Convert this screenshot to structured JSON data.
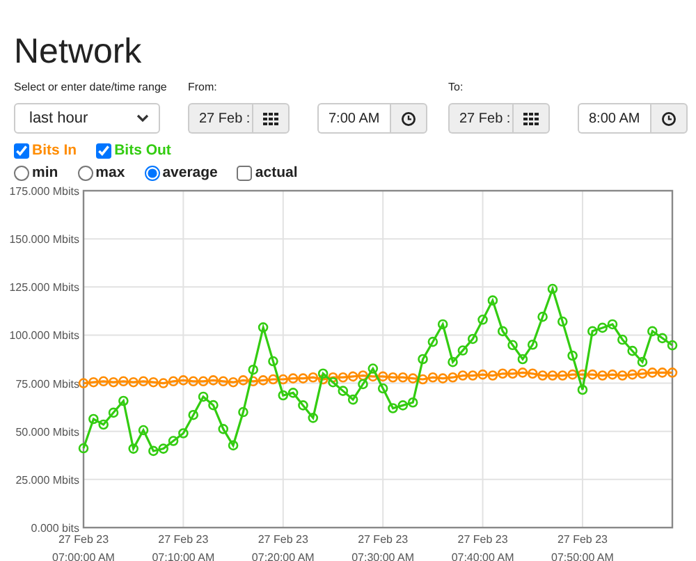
{
  "title": "Network",
  "range": {
    "label": "Select or enter date/time range",
    "value": "last hour"
  },
  "from": {
    "label": "From:",
    "date": "27 Feb :",
    "time": "7:00 AM"
  },
  "to": {
    "label": "To:",
    "date": "27 Feb :",
    "time": "8:00 AM"
  },
  "series_toggles": [
    {
      "checked": true
    },
    {
      "checked": true
    }
  ],
  "modes": [
    {
      "label": "min",
      "kind": "radio",
      "selected": false
    },
    {
      "label": "max",
      "kind": "radio",
      "selected": false
    },
    {
      "label": "average",
      "kind": "radio",
      "selected": true
    },
    {
      "label": "actual",
      "kind": "checkbox",
      "selected": false
    }
  ],
  "chart_data": {
    "type": "line",
    "categories": [
      "27 Feb 23\n07:00:00 AM",
      null,
      null,
      null,
      null,
      null,
      null,
      null,
      null,
      null,
      "27 Feb 23\n07:10:00 AM",
      null,
      null,
      null,
      null,
      null,
      null,
      null,
      null,
      null,
      "27 Feb 23\n07:20:00 AM",
      null,
      null,
      null,
      null,
      null,
      null,
      null,
      null,
      null,
      "27 Feb 23\n07:30:00 AM",
      null,
      null,
      null,
      null,
      null,
      null,
      null,
      null,
      null,
      "27 Feb 23\n07:40:00 AM",
      null,
      null,
      null,
      null,
      null,
      null,
      null,
      null,
      null,
      "27 Feb 23\n07:50:00 AM",
      null,
      null,
      null,
      null,
      null,
      null,
      null,
      null,
      null
    ],
    "ylim": [
      0,
      175
    ],
    "grid": true,
    "yticks": [
      {
        "value": 0,
        "label": "0.000 bits"
      },
      {
        "value": 25,
        "label": "25.000 Mbits"
      },
      {
        "value": 50,
        "label": "50.000 Mbits"
      },
      {
        "value": 75,
        "label": "75.000 Mbits"
      },
      {
        "value": 100,
        "label": "100.000 Mbits"
      },
      {
        "value": 125,
        "label": "125.000 Mbits"
      },
      {
        "value": 150,
        "label": "150.000 Mbits"
      },
      {
        "value": 175,
        "label": "175.000 Mbits"
      }
    ],
    "series": [
      {
        "name": "Bits In",
        "color": "#ff8c00",
        "marker": "o",
        "values": [
          75,
          75.5,
          76,
          75.5,
          76,
          75.5,
          76,
          75.5,
          75,
          76,
          76.5,
          76,
          76,
          76.5,
          76,
          75.5,
          76.5,
          76,
          76.5,
          77,
          77,
          77.5,
          77.5,
          78,
          77,
          78,
          78,
          78.5,
          79,
          78.5,
          78.5,
          78,
          78,
          77.5,
          77,
          78,
          77.5,
          78,
          79,
          79,
          79.5,
          79,
          80,
          80,
          80.5,
          80,
          79,
          79,
          79,
          79.5,
          79.5,
          79.5,
          79,
          79.5,
          79,
          79.5,
          80,
          80.5,
          80.5,
          80.5
        ]
      },
      {
        "name": "Bits Out",
        "color": "#33cc11",
        "marker": "o",
        "values": [
          41.2,
          56.4,
          53.5,
          59.7,
          65.8,
          41,
          50.6,
          39.8,
          41,
          45,
          49,
          58.5,
          68,
          63.6,
          51.2,
          42.7,
          60,
          82,
          104,
          86.4,
          68.7,
          70,
          63.5,
          57,
          80,
          75.5,
          71,
          66.5,
          74.5,
          82.6,
          72.3,
          62,
          63.5,
          65,
          87.5,
          96.5,
          105.6,
          86,
          92,
          98,
          108,
          118,
          102,
          94.8,
          87.5,
          95,
          109.5,
          124,
          107,
          89.3,
          71.6,
          102,
          103.8,
          105.6,
          97.6,
          91.8,
          86,
          102,
          98.4,
          94.7
        ]
      }
    ]
  }
}
